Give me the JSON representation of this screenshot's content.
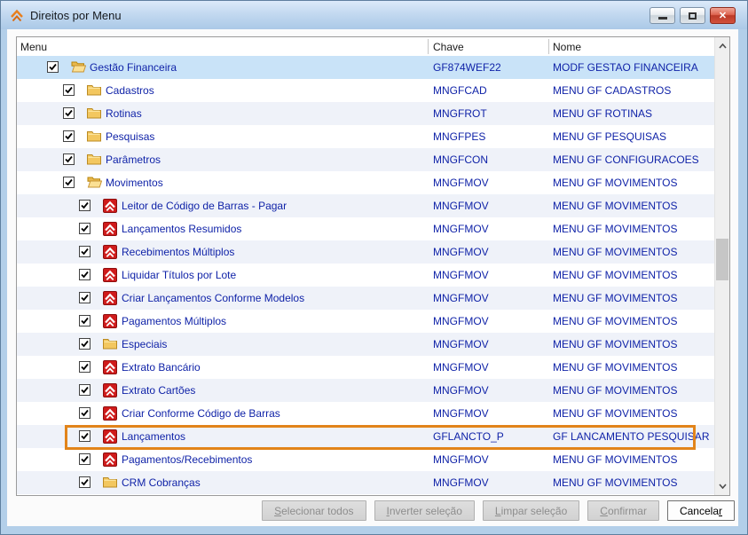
{
  "window": {
    "title": "Direitos por Menu",
    "titlebar_icon": "chevron-logo-icon",
    "controls": [
      {
        "icon": "minimize-icon"
      },
      {
        "icon": "maximize-icon"
      },
      {
        "icon": "close-icon"
      }
    ]
  },
  "table": {
    "columns": [
      "Menu",
      "Chave",
      "Nome"
    ],
    "rows": [
      {
        "label": "Gestão Financeira",
        "chave": "GF874WEF22",
        "nome": "MODF GESTAO FINANCEIRA",
        "level": 1,
        "icon": "folder-open",
        "checked": true,
        "selected": true
      },
      {
        "label": "Cadastros",
        "chave": "MNGFCAD",
        "nome": "MENU GF CADASTROS",
        "level": 2,
        "icon": "folder",
        "checked": true
      },
      {
        "label": "Rotinas",
        "chave": "MNGFROT",
        "nome": "MENU GF ROTINAS",
        "level": 2,
        "icon": "folder",
        "checked": true
      },
      {
        "label": "Pesquisas",
        "chave": "MNGFPES",
        "nome": "MENU GF PESQUISAS",
        "level": 2,
        "icon": "folder",
        "checked": true
      },
      {
        "label": "Parâmetros",
        "chave": "MNGFCON",
        "nome": "MENU GF CONFIGURACOES",
        "level": 2,
        "icon": "folder",
        "checked": true
      },
      {
        "label": "Movimentos",
        "chave": "MNGFMOV",
        "nome": "MENU GF MOVIMENTOS",
        "level": 2,
        "icon": "folder-open",
        "checked": true
      },
      {
        "label": "Leitor de Código de Barras - Pagar",
        "chave": "MNGFMOV",
        "nome": "MENU GF MOVIMENTOS",
        "level": 3,
        "icon": "app",
        "checked": true
      },
      {
        "label": "Lançamentos Resumidos",
        "chave": "MNGFMOV",
        "nome": "MENU GF MOVIMENTOS",
        "level": 3,
        "icon": "app",
        "checked": true
      },
      {
        "label": "Recebimentos Múltiplos",
        "chave": "MNGFMOV",
        "nome": "MENU GF MOVIMENTOS",
        "level": 3,
        "icon": "app",
        "checked": true
      },
      {
        "label": "Liquidar Títulos por Lote",
        "chave": "MNGFMOV",
        "nome": "MENU GF MOVIMENTOS",
        "level": 3,
        "icon": "app",
        "checked": true
      },
      {
        "label": "Criar Lançamentos Conforme Modelos",
        "chave": "MNGFMOV",
        "nome": "MENU GF MOVIMENTOS",
        "level": 3,
        "icon": "app",
        "checked": true
      },
      {
        "label": "Pagamentos Múltiplos",
        "chave": "MNGFMOV",
        "nome": "MENU GF MOVIMENTOS",
        "level": 3,
        "icon": "app",
        "checked": true
      },
      {
        "label": "Especiais",
        "chave": "MNGFMOV",
        "nome": "MENU GF MOVIMENTOS",
        "level": 3,
        "icon": "folder",
        "checked": true
      },
      {
        "label": "Extrato Bancário",
        "chave": "MNGFMOV",
        "nome": "MENU GF MOVIMENTOS",
        "level": 3,
        "icon": "app",
        "checked": true
      },
      {
        "label": "Extrato Cartões",
        "chave": "MNGFMOV",
        "nome": "MENU GF MOVIMENTOS",
        "level": 3,
        "icon": "app",
        "checked": true
      },
      {
        "label": "Criar Conforme Código de Barras",
        "chave": "MNGFMOV",
        "nome": "MENU GF MOVIMENTOS",
        "level": 3,
        "icon": "app",
        "checked": true
      },
      {
        "label": "Lançamentos",
        "chave": "GFLANCTO_P",
        "nome": "GF LANCAMENTO PESQUISAR",
        "level": 3,
        "icon": "app",
        "checked": true,
        "highlighted": true
      },
      {
        "label": "Pagamentos/Recebimentos",
        "chave": "MNGFMOV",
        "nome": "MENU GF MOVIMENTOS",
        "level": 3,
        "icon": "app",
        "checked": true
      },
      {
        "label": "CRM Cobranças",
        "chave": "MNGFMOV",
        "nome": "MENU GF MOVIMENTOS",
        "level": 3,
        "icon": "folder",
        "checked": true
      }
    ]
  },
  "buttons": [
    {
      "label": "Selecionar todos",
      "mnemonic_index": 0,
      "enabled": false
    },
    {
      "label": "Inverter seleção",
      "mnemonic_index": 0,
      "enabled": false
    },
    {
      "label": "Limpar seleção",
      "mnemonic_index": 0,
      "enabled": false
    },
    {
      "label": "Confirmar",
      "mnemonic_index": 0,
      "enabled": false
    },
    {
      "label": "Cancelar",
      "mnemonic_index": 7,
      "enabled": true
    }
  ],
  "colors": {
    "accent_highlight": "#e2841a",
    "selected_row": "#c9e3f8",
    "alt_row": "#eff2f9",
    "row_text": "#1023a8",
    "window_frame": "#b3cfe9",
    "app_icon_red": "#cf1b1b",
    "close_button_red": "#c8402c",
    "folder_yellow": "#f3c75f"
  }
}
